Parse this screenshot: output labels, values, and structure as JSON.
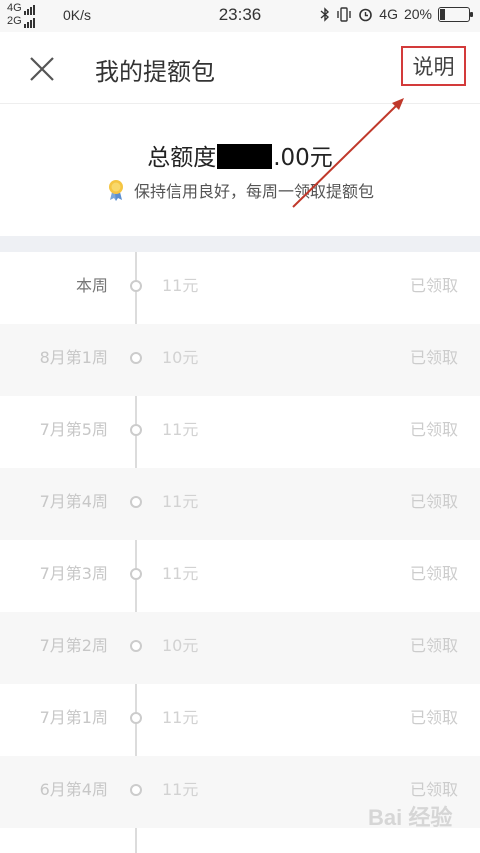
{
  "status_bar": {
    "net_top": "4G",
    "net_bottom": "2G",
    "speed": "0K/s",
    "time": "23:36",
    "network": "4G",
    "battery": "20%",
    "battery_level": 0.2
  },
  "header": {
    "title": "我的提额包",
    "explain_label": "说明"
  },
  "quota": {
    "total_prefix": "总额度",
    "total_suffix": ".00元",
    "tip": "保持信用良好，每周一领取提额包"
  },
  "weeks": [
    {
      "week": "本周",
      "amount": "11元",
      "status": "已领取"
    },
    {
      "week": "8月第1周",
      "amount": "10元",
      "status": "已领取"
    },
    {
      "week": "7月第5周",
      "amount": "11元",
      "status": "已领取"
    },
    {
      "week": "7月第4周",
      "amount": "11元",
      "status": "已领取"
    },
    {
      "week": "7月第3周",
      "amount": "11元",
      "status": "已领取"
    },
    {
      "week": "7月第2周",
      "amount": "10元",
      "status": "已领取"
    },
    {
      "week": "7月第1周",
      "amount": "11元",
      "status": "已领取"
    },
    {
      "week": "6月第4周",
      "amount": "11元",
      "status": "已领取"
    }
  ],
  "colors": {
    "annotation": "#c0392b",
    "divider": "#eef0f4"
  },
  "watermark": "Bai 经验"
}
